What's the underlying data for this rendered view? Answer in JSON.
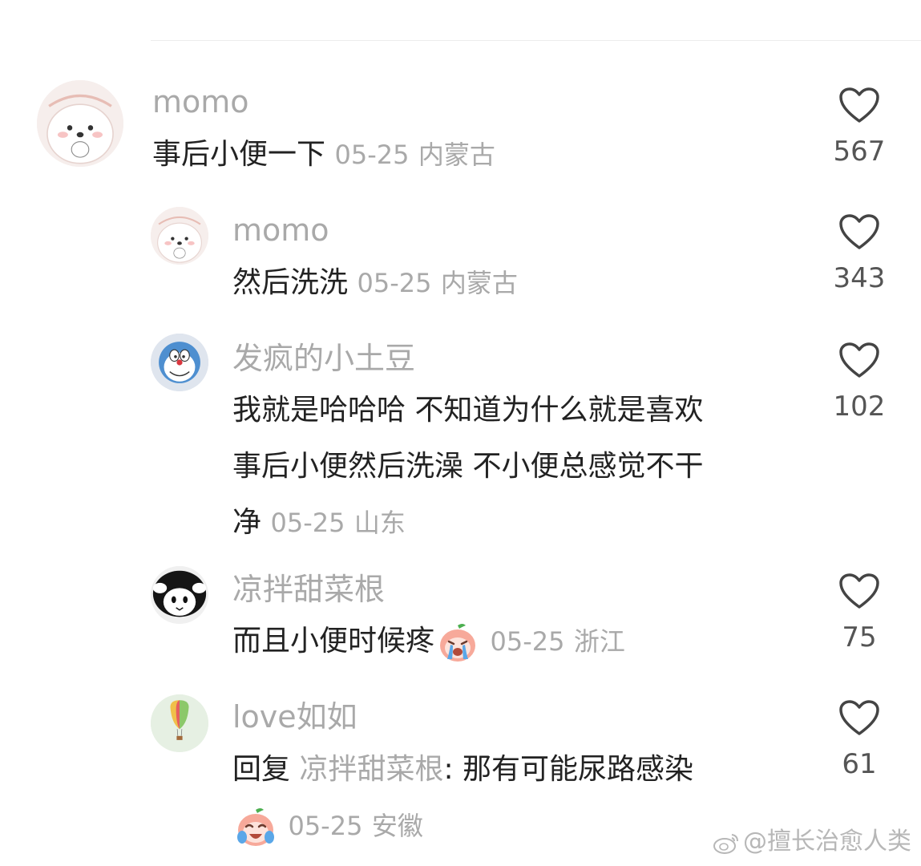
{
  "comments": [
    {
      "username": "momo",
      "text": "事后小便一下",
      "date": "05-25",
      "location": "内蒙古",
      "likes": "567",
      "level": "top",
      "avatar": "cartoon-seal-avatar"
    },
    {
      "username": "momo",
      "text": "然后洗洗",
      "date": "05-25",
      "location": "内蒙古",
      "likes": "343",
      "level": "reply",
      "avatar": "cartoon-seal-avatar"
    },
    {
      "username": "发疯的小土豆",
      "text_lines": [
        "我就是哈哈哈 不知道为什么就是喜欢",
        "事后小便然后洗澡 不小便总感觉不干",
        "净"
      ],
      "date": "05-25",
      "location": "山东",
      "likes": "102",
      "level": "reply",
      "avatar": "doraemon-avatar"
    },
    {
      "username": "凉拌甜菜根",
      "text": "而且小便时候疼",
      "emoji": "crying-peach-emoji",
      "date": "05-25",
      "location": "浙江",
      "likes": "75",
      "level": "reply",
      "avatar": "black-white-plush-avatar"
    },
    {
      "username": "love如如",
      "reply_prefix": "回复",
      "reply_target": "凉拌甜菜根",
      "text": ": 那有可能尿路感染",
      "emoji": "laughing-crying-peach-emoji",
      "date": "05-25",
      "location": "安徽",
      "likes": "61",
      "level": "reply",
      "avatar": "hot-air-balloon-avatar"
    }
  ],
  "watermark": "@擅长治愈人类",
  "colors": {
    "username": "#a9a9a9",
    "text": "#222222",
    "meta": "#a9a9a9",
    "likes": "#555555"
  }
}
